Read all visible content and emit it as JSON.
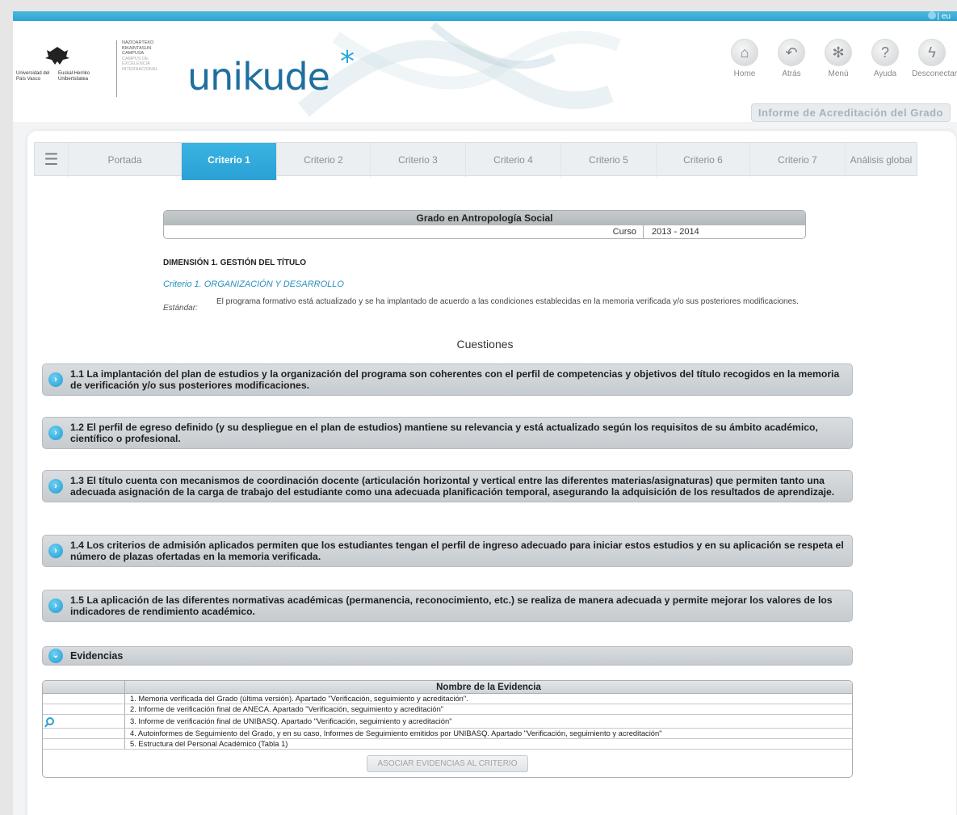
{
  "lang": "| eu",
  "logos": {
    "upv_left": "Universidad del País Vasco",
    "upv_right": "Euskal Herriko Unibertsitatea",
    "campus_lines": [
      "NAZIOARTEKO",
      "BIKAINTASUN",
      "CAMPUSA",
      "CAMPUS DE",
      "EXCELENCIA",
      "INTERNACIONAL"
    ],
    "brand": "unikude",
    "brand_star": "*"
  },
  "nav": [
    {
      "label": "Home",
      "icon": "home-icon"
    },
    {
      "label": "Atrás",
      "icon": "back-arrow-icon"
    },
    {
      "label": "Menú",
      "icon": "menu-asterisk-icon"
    },
    {
      "label": "Ayuda",
      "icon": "help-icon"
    },
    {
      "label": "Desconectar",
      "icon": "lightning-icon"
    }
  ],
  "report_title": "Informe de Acreditación del Grado",
  "tabs": [
    "Portada",
    "Criterio 1",
    "Criterio 2",
    "Criterio 3",
    "Criterio 4",
    "Criterio 5",
    "Criterio 6",
    "Criterio 7",
    "Análisis global"
  ],
  "active_tab": "Criterio 1",
  "grado": {
    "title": "Grado en Antropología Social",
    "curso_label": "Curso",
    "curso_value": "2013 - 2014"
  },
  "dimension": "DIMENSIÓN 1. GESTIÓN DEL TÍTULO",
  "criterio": "Criterio 1. ORGANIZACIÓN Y DESARROLLO",
  "estandar_label": "Estándar:",
  "estandar_text": "El programa formativo está actualizado y se ha implantado de acuerdo a las condiciones establecidas en la memoria verificada y/o sus posteriores modificaciones.",
  "cuestiones_title": "Cuestiones",
  "cuestiones": [
    "1.1  La implantación del plan de estudios y la organización del programa son coherentes con el perfil de competencias y objetivos del título recogidos en la memoria de verificación y/o sus posteriores modificaciones.",
    "1.2  El perfil de egreso definido (y su despliegue en el plan de estudios) mantiene su relevancia y está actualizado según los requisitos de su ámbito académico, científico o profesional.",
    "1.3  El título cuenta con mecanismos de coordinación docente (articulación horizontal y vertical entre las diferentes materias/asignaturas) que permiten tanto una adecuada asignación de la carga de trabajo del estudiante como una adecuada planificación temporal, asegurando la adquisición de los resultados de aprendizaje.",
    "1.4  Los criterios de admisión aplicados permiten que los estudiantes tengan el perfil de ingreso adecuado para iniciar estos estudios y en su aplicación se respeta el número de plazas ofertadas en la memoria verificada.",
    "1.5  La aplicación de las diferentes normativas académicas (permanencia, reconocimiento, etc.) se realiza de manera adecuada y permite mejorar los valores de los indicadores de rendimiento académico."
  ],
  "evidencias_title": "Evidencias",
  "evidencias_header": "Nombre de la Evidencia",
  "evidencias": [
    "1. Memoria verificada del Grado (última versión). Apartado \"Verificación, seguimiento y acreditación\".",
    "2. Informe de verificación final de ANECA. Apartado \"Verificación, seguimiento y acreditación\"",
    "3. Informe de verificación final de UNIBASQ. Apartado \"Verificación, seguimiento y acreditación\"",
    "4. Autoinformes de Seguimiento del Grado, y en su caso, Informes de Seguimiento emitidos por UNIBASQ. Apartado \"Verificación, seguimiento y acreditación\"",
    "5. Estructura del Personal Académico (Tabla 1)"
  ],
  "associate_button": "ASOCIAR EVIDENCIAS AL CRITERIO"
}
